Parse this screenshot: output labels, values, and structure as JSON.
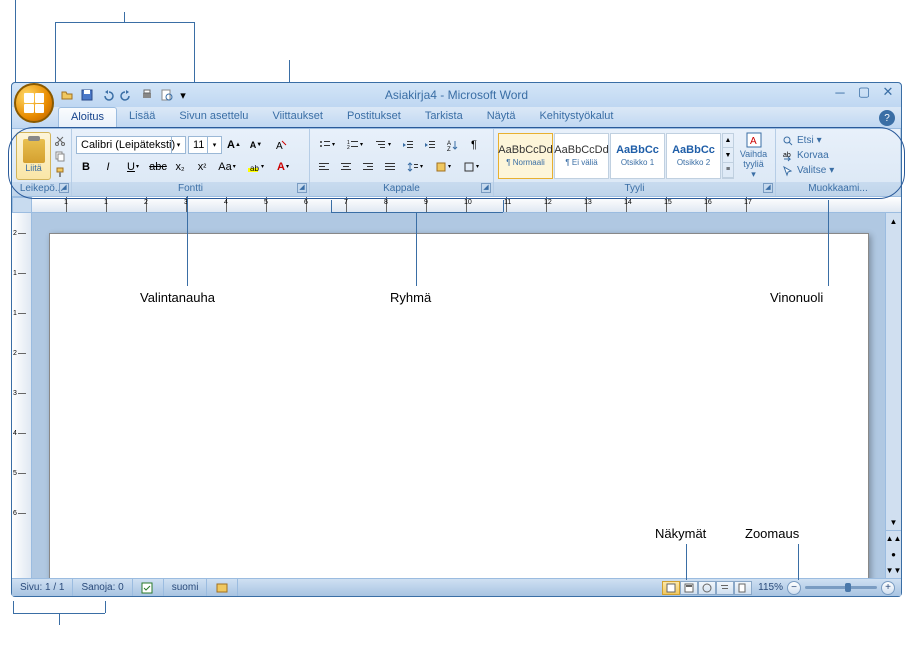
{
  "title": "Asiakirja4 - Microsoft Word",
  "tabs": [
    "Aloitus",
    "Lisää",
    "Sivun asettelu",
    "Viittaukset",
    "Postitukset",
    "Tarkista",
    "Näytä",
    "Kehitystyökalut"
  ],
  "clipboard": {
    "paste": "Liitä",
    "label": "Leikepö..."
  },
  "font": {
    "name": "Calibri (Leipäteksti)",
    "size": "11",
    "label": "Fontti"
  },
  "paragraph": {
    "label": "Kappale"
  },
  "styles": {
    "label": "Tyyli",
    "items": [
      {
        "preview": "AaBbCcDd",
        "name": "¶ Normaali",
        "blue": false
      },
      {
        "preview": "AaBbCcDd",
        "name": "¶ Ei väliä",
        "blue": false
      },
      {
        "preview": "AaBbCc",
        "name": "Otsikko 1",
        "blue": true
      },
      {
        "preview": "AaBbCc",
        "name": "Otsikko 2",
        "blue": true
      }
    ],
    "change": "Vaihda tyyliä"
  },
  "editing": {
    "label": "Muokkaami...",
    "find": "Etsi",
    "replace": "Korvaa",
    "select": "Valitse"
  },
  "ruler_marks": [
    "1",
    "1",
    "2",
    "3",
    "4",
    "5",
    "6",
    "7",
    "8",
    "9",
    "10",
    "11",
    "12",
    "13",
    "14",
    "15",
    "16",
    "17"
  ],
  "vruler": [
    "2",
    "1",
    "1",
    "2",
    "3",
    "4",
    "5",
    "6"
  ],
  "status": {
    "page": "Sivu: 1 / 1",
    "words": "Sanoja: 0",
    "lang": "suomi",
    "zoom": "115%"
  },
  "callouts": {
    "ribbon": "Valintanauha",
    "group": "Ryhmä",
    "launcher": "Vinonuoli",
    "views": "Näkymät",
    "zoom": "Zoomaus"
  }
}
